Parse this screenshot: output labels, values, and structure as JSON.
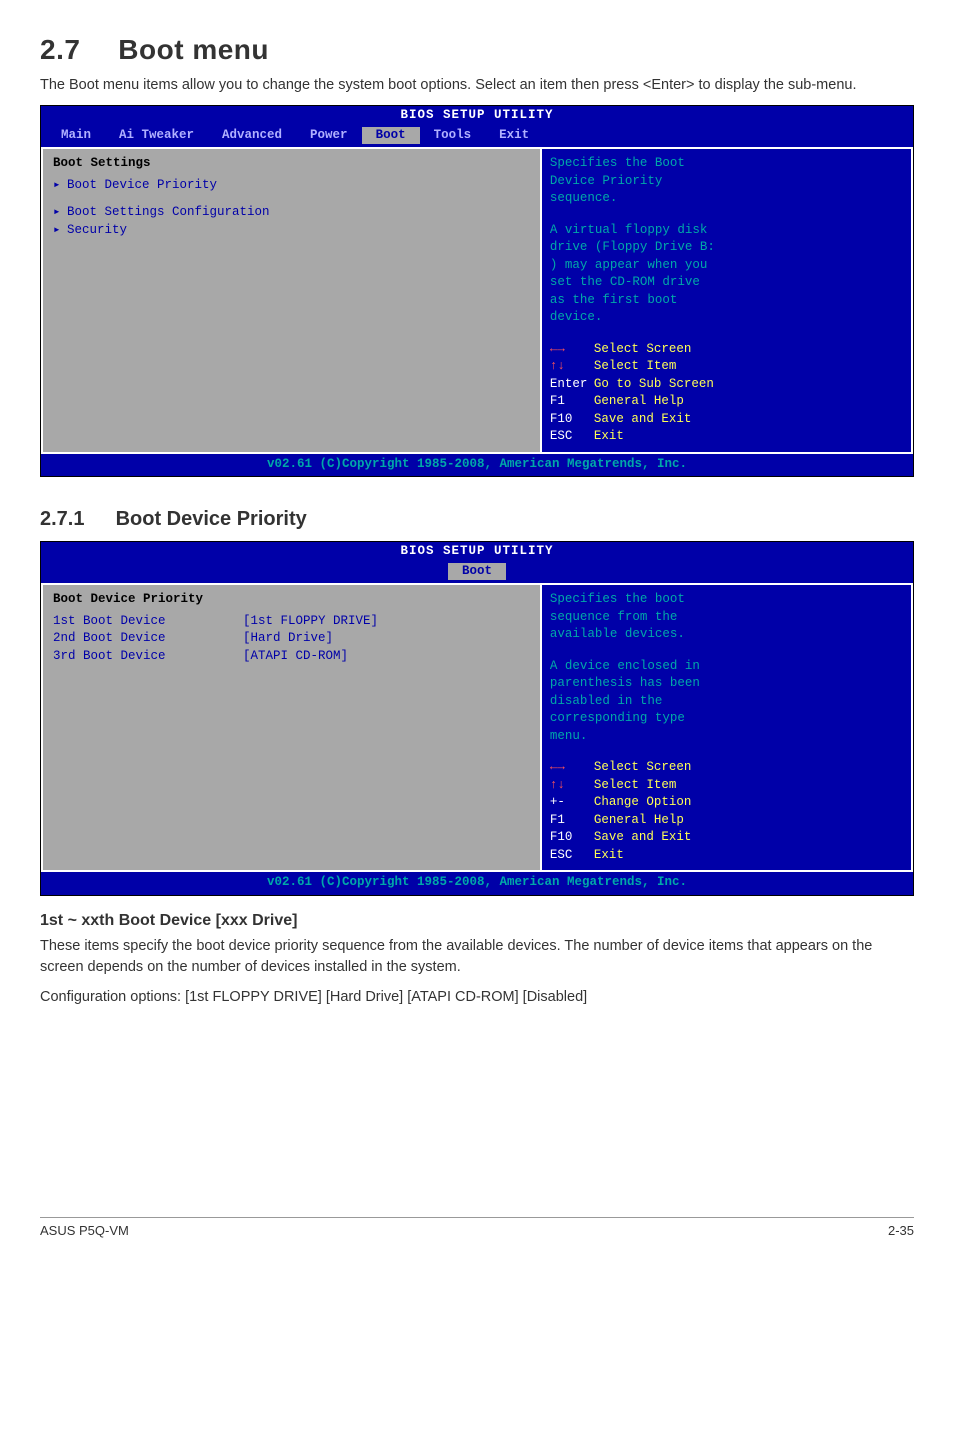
{
  "section": {
    "number": "2.7",
    "title": "Boot menu"
  },
  "intro": "The Boot menu items allow you to change the system boot options. Select an item then press <Enter> to display the sub-menu.",
  "bios1": {
    "setup_title": "BIOS SETUP UTILITY",
    "tabs": [
      "Main",
      "Ai Tweaker",
      "Advanced",
      "Power",
      "Boot",
      "Tools",
      "Exit"
    ],
    "active_tab": "Boot",
    "left": {
      "heading": "Boot Settings",
      "items": [
        "Boot Device Priority",
        "Boot Settings Configuration",
        "Security"
      ]
    },
    "right_help": [
      "Specifies the Boot",
      "Device Priority",
      "sequence.",
      "",
      "A virtual floppy disk",
      "drive (Floppy Drive B:",
      ") may appear when you",
      "set the CD-ROM drive",
      "as the first boot",
      "device."
    ],
    "right_keys": [
      {
        "key": "←→",
        "desc": "Select Screen",
        "arrow": true
      },
      {
        "key": "↑↓",
        "desc": "Select Item",
        "arrow": true
      },
      {
        "key": "Enter",
        "desc": "Go to Sub Screen"
      },
      {
        "key": "F1",
        "desc": "General Help"
      },
      {
        "key": "F10",
        "desc": "Save and Exit"
      },
      {
        "key": "ESC",
        "desc": "Exit"
      }
    ],
    "footer": "v02.61 (C)Copyright 1985-2008, American Megatrends, Inc."
  },
  "subsection": {
    "number": "2.7.1",
    "title": "Boot Device Priority"
  },
  "bios2": {
    "setup_title": "BIOS SETUP UTILITY",
    "tabs_single": "Boot",
    "left": {
      "heading": "Boot Device Priority",
      "rows": [
        {
          "k": "1st Boot Device",
          "v": "[1st FLOPPY DRIVE]"
        },
        {
          "k": "2nd Boot Device",
          "v": "[Hard Drive]"
        },
        {
          "k": "3rd Boot Device",
          "v": "[ATAPI CD-ROM]"
        }
      ]
    },
    "right_help": [
      "Specifies the boot",
      "sequence from the",
      "available devices.",
      "",
      "A device enclosed in",
      "parenthesis has been",
      "disabled in the",
      "corresponding type",
      "menu."
    ],
    "right_keys": [
      {
        "key": "←→",
        "desc": "Select Screen",
        "arrow": true
      },
      {
        "key": "↑↓",
        "desc": "Select Item",
        "arrow": true
      },
      {
        "key": "+-",
        "desc": "Change Option"
      },
      {
        "key": "F1",
        "desc": "General Help"
      },
      {
        "key": "F10",
        "desc": "Save and Exit"
      },
      {
        "key": "ESC",
        "desc": "Exit"
      }
    ],
    "footer": "v02.61 (C)Copyright 1985-2008, American Megatrends, Inc."
  },
  "param_heading": "1st ~ xxth Boot Device [xxx Drive]",
  "param_p1": "These items specify the boot device priority sequence from the available devices. The number of device items that appears on the screen depends on the number of devices installed in the system.",
  "param_p2": "Configuration options: [1st FLOPPY DRIVE] [Hard Drive] [ATAPI CD-ROM] [Disabled]",
  "footer": {
    "left": "ASUS P5Q-VM",
    "right": "2-35"
  }
}
